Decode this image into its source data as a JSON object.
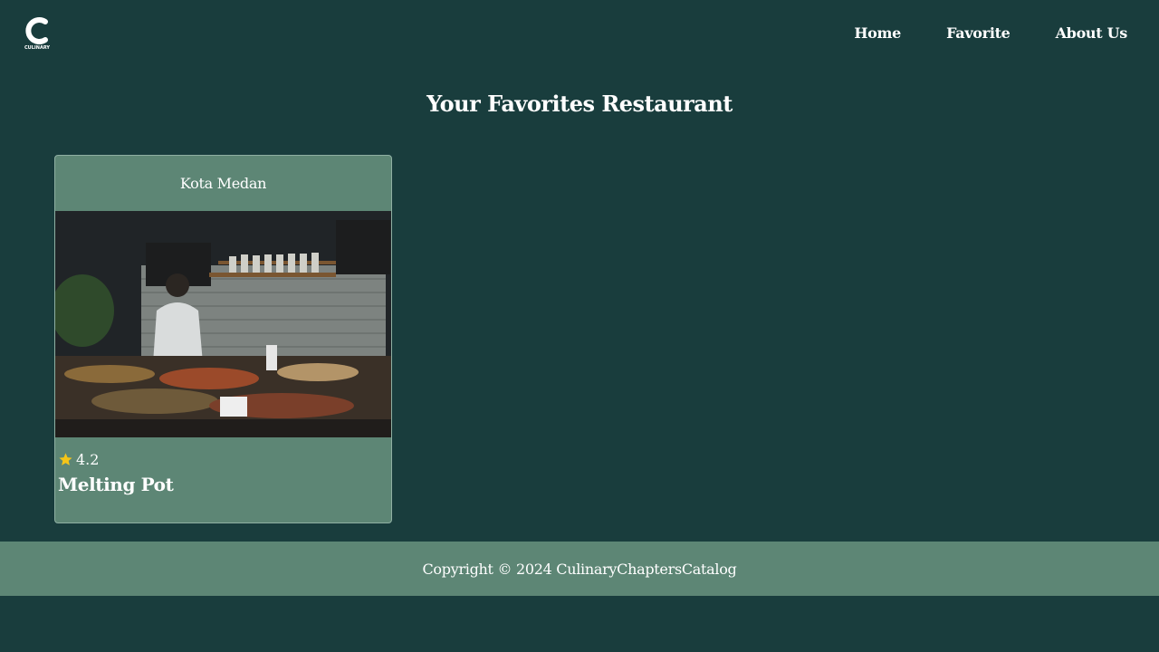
{
  "header": {
    "logo_text": "CULINARY CHAPTERS",
    "nav": [
      {
        "label": "Home"
      },
      {
        "label": "Favorite"
      },
      {
        "label": "About Us"
      }
    ]
  },
  "main": {
    "title": "Your Favorites Restaurant",
    "restaurants": [
      {
        "city": "Kota Medan",
        "rating": "4.2",
        "name": "Melting Pot",
        "image_icon": "restaurant-photo"
      }
    ]
  },
  "footer": {
    "copyright": "Copyright © 2024 CulinaryChaptersCatalog"
  },
  "colors": {
    "background": "#193d3d",
    "card": "#5d8675",
    "footer": "#5d8675",
    "star": "#f5c518"
  }
}
